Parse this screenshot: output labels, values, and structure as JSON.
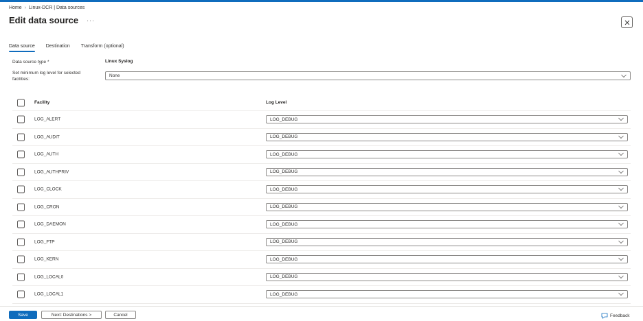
{
  "breadcrumb": {
    "items": [
      "Home",
      "Linux-DCR | Data sources"
    ],
    "separator": "›"
  },
  "header": {
    "title": "Edit data source",
    "more_label": "···"
  },
  "tabs": [
    {
      "label": "Data source",
      "active": true
    },
    {
      "label": "Destination",
      "active": false
    },
    {
      "label": "Transform (optional)",
      "active": false
    }
  ],
  "form": {
    "type_label": "Data source type *",
    "type_value": "Linux Syslog",
    "min_level_label_line1": "Set minimum log level for selected",
    "min_level_label_line2": "facilities:",
    "min_level_value": "None"
  },
  "table": {
    "col_facility": "Facility",
    "col_level": "Log Level",
    "rows": [
      {
        "facility": "LOG_ALERT",
        "level": "LOG_DEBUG"
      },
      {
        "facility": "LOG_AUDIT",
        "level": "LOG_DEBUG"
      },
      {
        "facility": "LOG_AUTH",
        "level": "LOG_DEBUG"
      },
      {
        "facility": "LOG_AUTHPRIV",
        "level": "LOG_DEBUG"
      },
      {
        "facility": "LOG_CLOCK",
        "level": "LOG_DEBUG"
      },
      {
        "facility": "LOG_CRON",
        "level": "LOG_DEBUG"
      },
      {
        "facility": "LOG_DAEMON",
        "level": "LOG_DEBUG"
      },
      {
        "facility": "LOG_FTP",
        "level": "LOG_DEBUG"
      },
      {
        "facility": "LOG_KERN",
        "level": "LOG_DEBUG"
      },
      {
        "facility": "LOG_LOCAL0",
        "level": "LOG_DEBUG"
      },
      {
        "facility": "LOG_LOCAL1",
        "level": "LOG_DEBUG"
      }
    ]
  },
  "footer": {
    "save_label": "Save",
    "next_label": "Next: Destinations >",
    "cancel_label": "Cancel",
    "feedback_label": "Feedback"
  },
  "colors": {
    "accent": "#0f6cbd",
    "border": "#8a8886",
    "divider": "#edebe9"
  },
  "icons": {
    "close": "close-icon",
    "chevron": "chevron-down-icon",
    "feedback": "feedback-icon"
  }
}
